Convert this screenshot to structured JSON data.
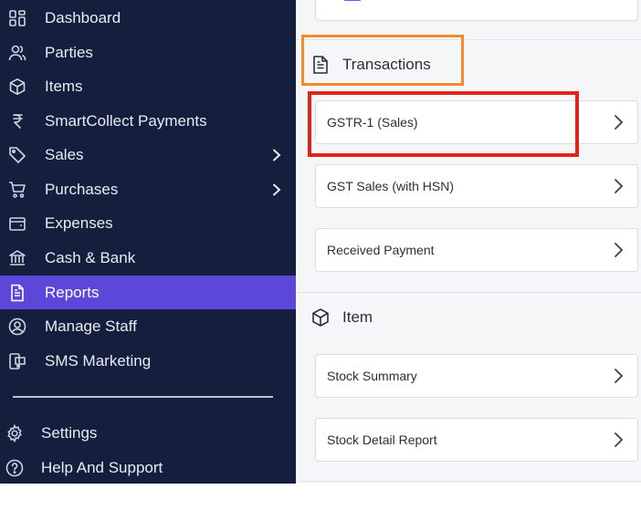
{
  "sidebar": {
    "items": [
      {
        "label": "Dashboard",
        "icon": "dashboard-icon"
      },
      {
        "label": "Parties",
        "icon": "users-icon"
      },
      {
        "label": "Items",
        "icon": "box-icon"
      },
      {
        "label": "SmartCollect Payments",
        "icon": "rupee-icon"
      },
      {
        "label": "Sales",
        "icon": "tag-icon",
        "has_submenu": true
      },
      {
        "label": "Purchases",
        "icon": "cart-icon",
        "has_submenu": true
      },
      {
        "label": "Expenses",
        "icon": "wallet-icon"
      },
      {
        "label": "Cash & Bank",
        "icon": "bank-icon"
      },
      {
        "label": "Reports",
        "icon": "report-icon",
        "active": true
      },
      {
        "label": "Manage Staff",
        "icon": "staff-icon"
      },
      {
        "label": "SMS Marketing",
        "icon": "sms-icon"
      }
    ],
    "bottom_items": [
      {
        "label": "Settings",
        "icon": "gear-icon"
      },
      {
        "label": "Help And Support",
        "icon": "help-icon"
      }
    ]
  },
  "main": {
    "sections": [
      {
        "title": "Transactions",
        "icon": "document-icon",
        "reports": [
          "GSTR-1 (Sales)",
          "GST Sales (with HSN)",
          "Received Payment"
        ]
      },
      {
        "title": "Item",
        "icon": "box-icon",
        "reports": [
          "Stock Summary",
          "Stock Detail Report"
        ]
      }
    ]
  },
  "colors": {
    "sidebar_bg": "#141f3d",
    "active_bg": "#5b48d9",
    "highlight_orange": "#f28a2e",
    "highlight_red": "#e2231a"
  }
}
